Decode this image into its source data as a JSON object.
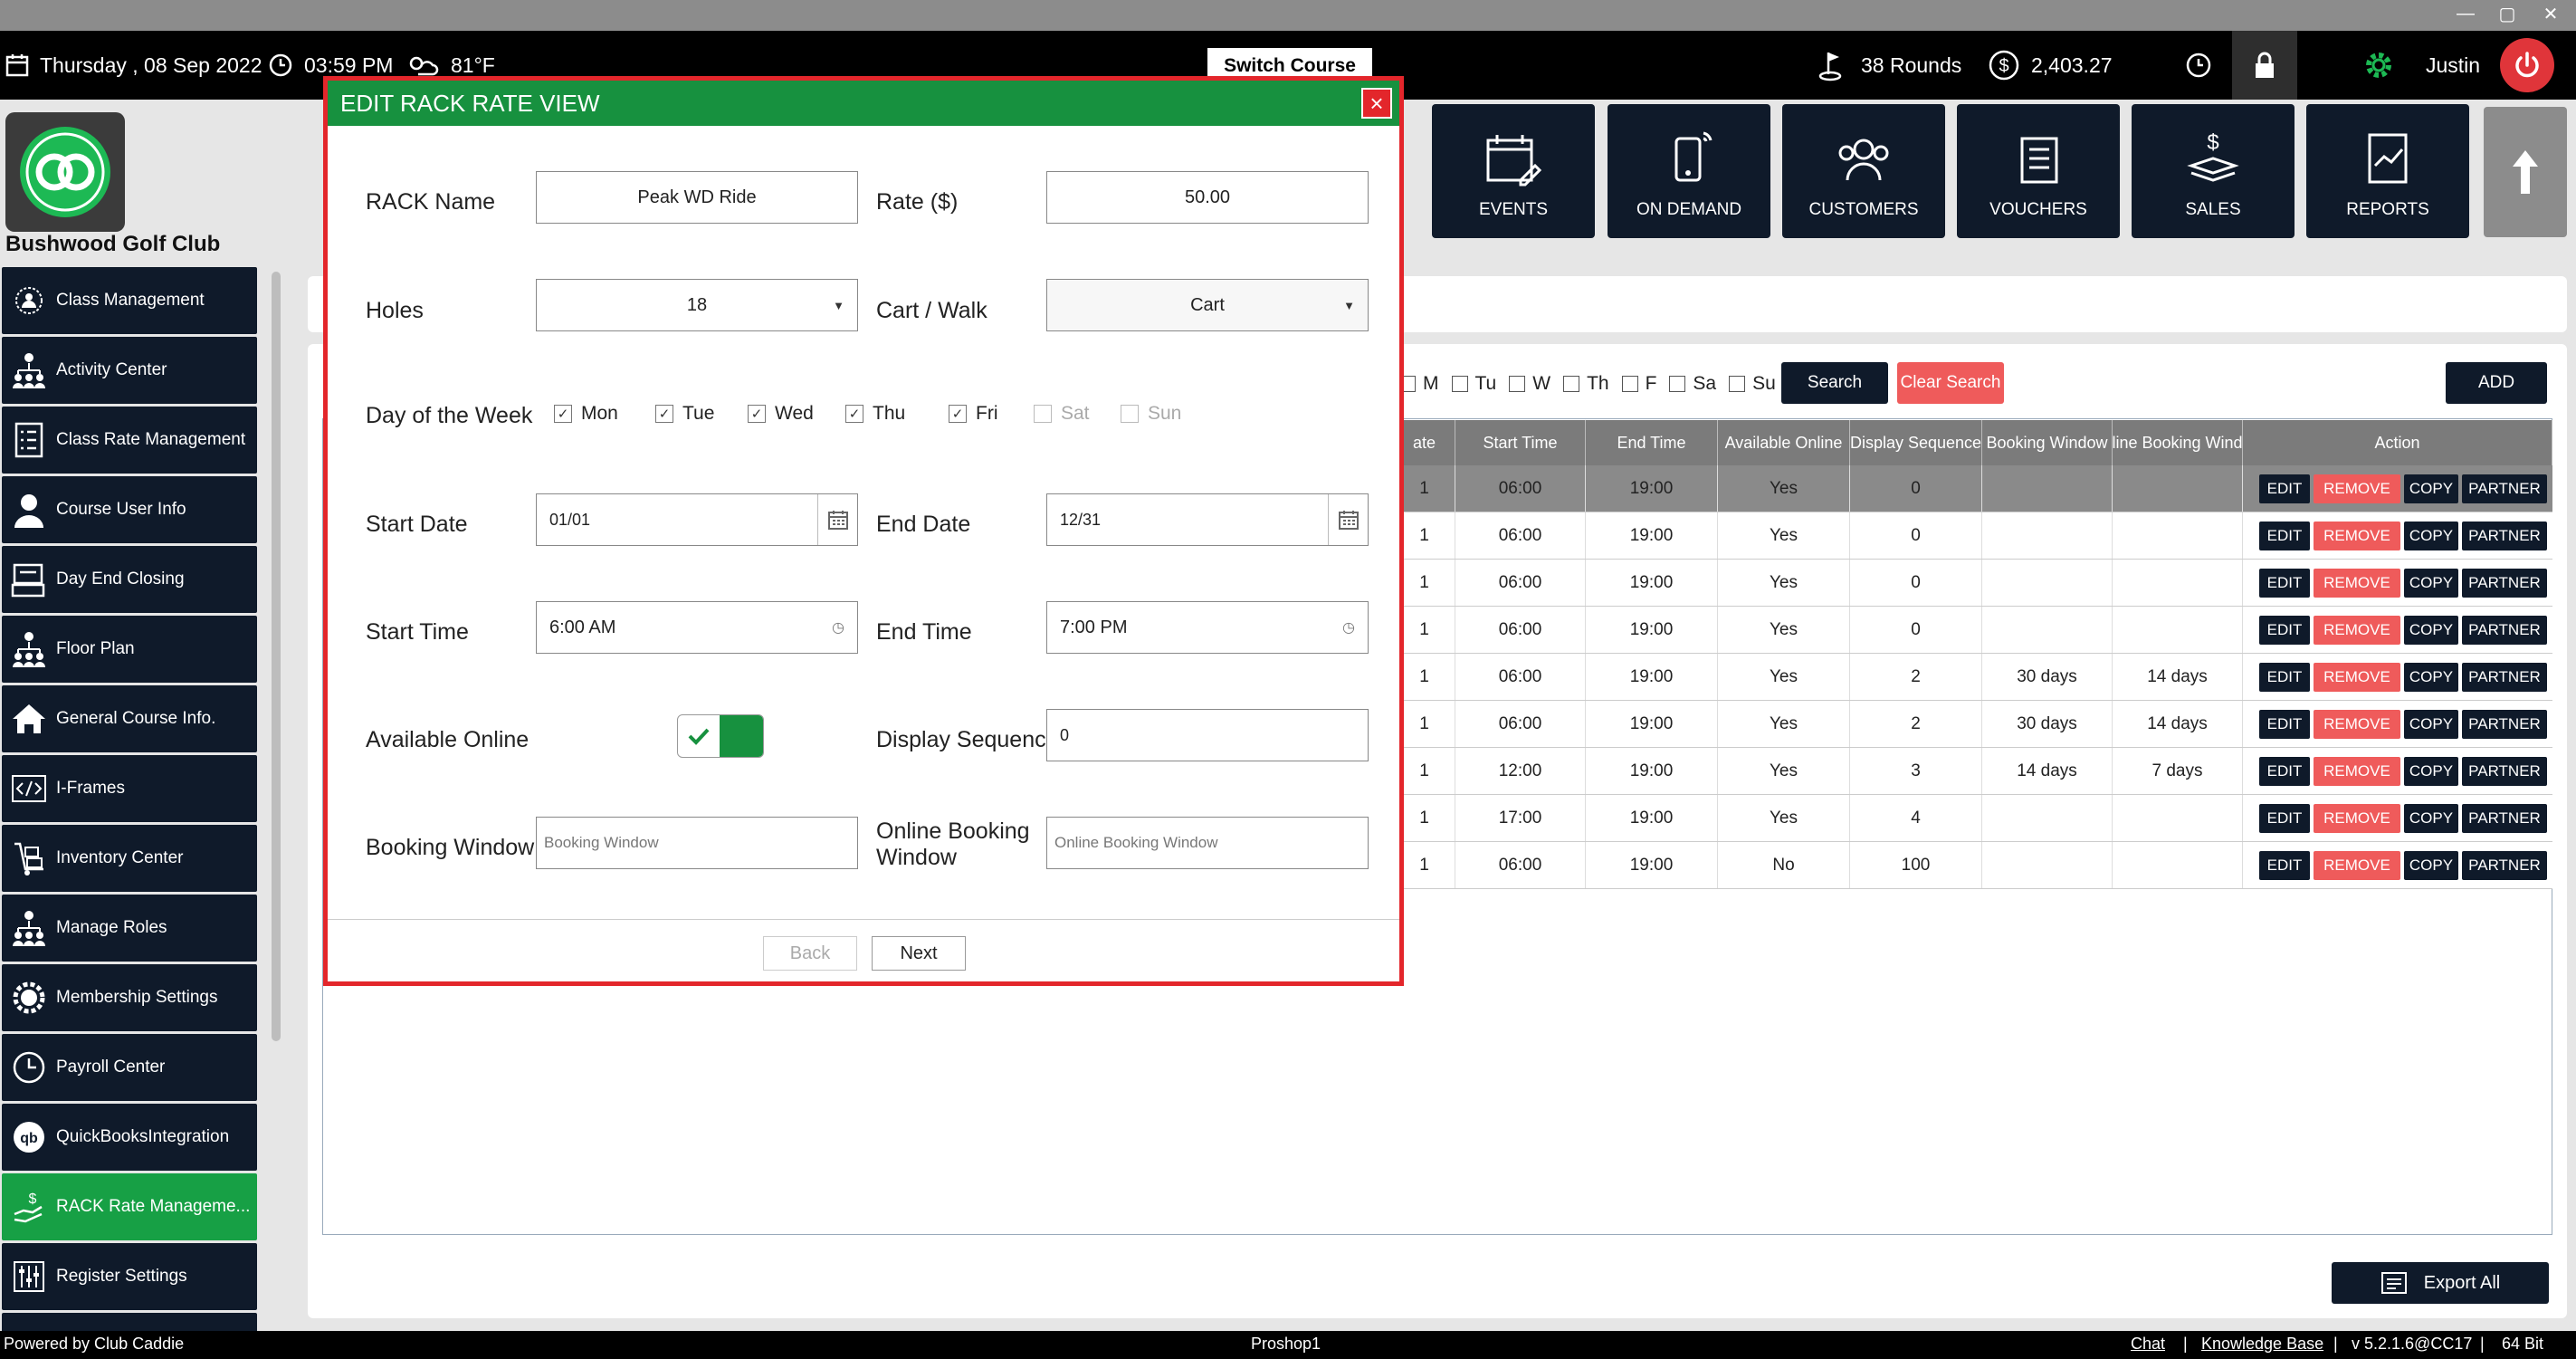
{
  "header": {
    "date": "Thursday ,  08 Sep 2022",
    "time": "03:59 PM",
    "weather": "81°F",
    "switch_course": "Switch Course",
    "rounds": "38 Rounds",
    "balance": "2,403.27",
    "user": "Justin"
  },
  "club": {
    "name": "Bushwood Golf Club"
  },
  "tiles": [
    {
      "label": "EVENTS",
      "icon": "calendar-pen-icon"
    },
    {
      "label": "ON DEMAND",
      "icon": "phone-signal-icon"
    },
    {
      "label": "CUSTOMERS",
      "icon": "users-icon"
    },
    {
      "label": "VOUCHERS",
      "icon": "receipt-icon"
    },
    {
      "label": "SALES",
      "icon": "cash-icon"
    },
    {
      "label": "REPORTS",
      "icon": "report-chart-icon"
    }
  ],
  "sidebar": {
    "items": [
      {
        "label": "Class Management"
      },
      {
        "label": "Activity Center"
      },
      {
        "label": "Class Rate Management"
      },
      {
        "label": "Course User Info"
      },
      {
        "label": "Day End Closing"
      },
      {
        "label": "Floor Plan"
      },
      {
        "label": "General Course Info."
      },
      {
        "label": "I-Frames"
      },
      {
        "label": "Inventory Center"
      },
      {
        "label": "Manage Roles"
      },
      {
        "label": "Membership Settings"
      },
      {
        "label": "Payroll Center"
      },
      {
        "label": "QuickBooksIntegration"
      },
      {
        "label": "RACK Rate Manageme..."
      },
      {
        "label": "Register Settings"
      }
    ]
  },
  "filters": {
    "days": [
      "M",
      "Tu",
      "W",
      "Th",
      "F",
      "Sa",
      "Su"
    ],
    "search": "Search",
    "clear": "Clear Search",
    "add": "ADD"
  },
  "table": {
    "columns": [
      "ate",
      "Start Time",
      "End Time",
      "Available Online",
      "Display Sequence",
      "Booking Window",
      "line Booking Wind",
      "Action"
    ],
    "rows": [
      {
        "c0": "1",
        "start": "06:00",
        "end": "19:00",
        "online": "Yes",
        "seq": "0",
        "bw": "",
        "obw": ""
      },
      {
        "c0": "1",
        "start": "06:00",
        "end": "19:00",
        "online": "Yes",
        "seq": "0",
        "bw": "",
        "obw": ""
      },
      {
        "c0": "1",
        "start": "06:00",
        "end": "19:00",
        "online": "Yes",
        "seq": "0",
        "bw": "",
        "obw": ""
      },
      {
        "c0": "1",
        "start": "06:00",
        "end": "19:00",
        "online": "Yes",
        "seq": "0",
        "bw": "",
        "obw": ""
      },
      {
        "c0": "1",
        "start": "06:00",
        "end": "19:00",
        "online": "Yes",
        "seq": "2",
        "bw": "30 days",
        "obw": "14 days"
      },
      {
        "c0": "1",
        "start": "06:00",
        "end": "19:00",
        "online": "Yes",
        "seq": "2",
        "bw": "30 days",
        "obw": "14 days"
      },
      {
        "c0": "1",
        "start": "12:00",
        "end": "19:00",
        "online": "Yes",
        "seq": "3",
        "bw": "14 days",
        "obw": "7 days"
      },
      {
        "c0": "1",
        "start": "17:00",
        "end": "19:00",
        "online": "Yes",
        "seq": "4",
        "bw": "",
        "obw": ""
      },
      {
        "c0": "1",
        "start": "06:00",
        "end": "19:00",
        "online": "No",
        "seq": "100",
        "bw": "",
        "obw": ""
      }
    ],
    "actions": {
      "edit": "EDIT",
      "remove": "REMOVE",
      "copy": "COPY",
      "partner": "PARTNER"
    }
  },
  "export_all": "Export All",
  "footer": {
    "powered": "Powered by Club Caddie",
    "station": "Proshop1",
    "chat": "Chat",
    "kb": "Knowledge Base",
    "version": "v 5.2.1.6@CC17",
    "bits": "64 Bit",
    "sep": "|"
  },
  "modal": {
    "title": "EDIT RACK RATE VIEW",
    "close": "×",
    "labels": {
      "rack_name": "RACK Name",
      "rate": "Rate ($)",
      "holes": "Holes",
      "cart_walk": "Cart / Walk",
      "day_of_week": "Day of the Week",
      "start_date": "Start Date",
      "end_date": "End Date",
      "start_time": "Start Time",
      "end_time": "End Time",
      "available_online": "Available Online",
      "display_sequence": "Display Sequence",
      "booking_window": "Booking Window",
      "online_booking_window_1": "Online Booking",
      "online_booking_window_2": "Window"
    },
    "values": {
      "rack_name": "Peak WD Ride",
      "rate": "50.00",
      "holes": "18",
      "cart_walk": "Cart",
      "start_date": "01/01",
      "end_date": "12/31",
      "start_time": "6:00 AM",
      "end_time": "7:00 PM",
      "display_sequence": "0",
      "available_online": true
    },
    "placeholders": {
      "booking_window": "Booking Window",
      "online_booking_window": "Online Booking Window"
    },
    "days": [
      {
        "label": "Mon",
        "checked": true
      },
      {
        "label": "Tue",
        "checked": true
      },
      {
        "label": "Wed",
        "checked": true
      },
      {
        "label": "Thu",
        "checked": true
      },
      {
        "label": "Fri",
        "checked": true
      },
      {
        "label": "Sat",
        "checked": false
      },
      {
        "label": "Sun",
        "checked": false
      }
    ],
    "back": "Back",
    "next": "Next"
  },
  "colors": {
    "brand_green": "#17913f",
    "navy": "#0f1a2a",
    "danger": "#ef5b5b",
    "modal_border": "#e3262b"
  }
}
